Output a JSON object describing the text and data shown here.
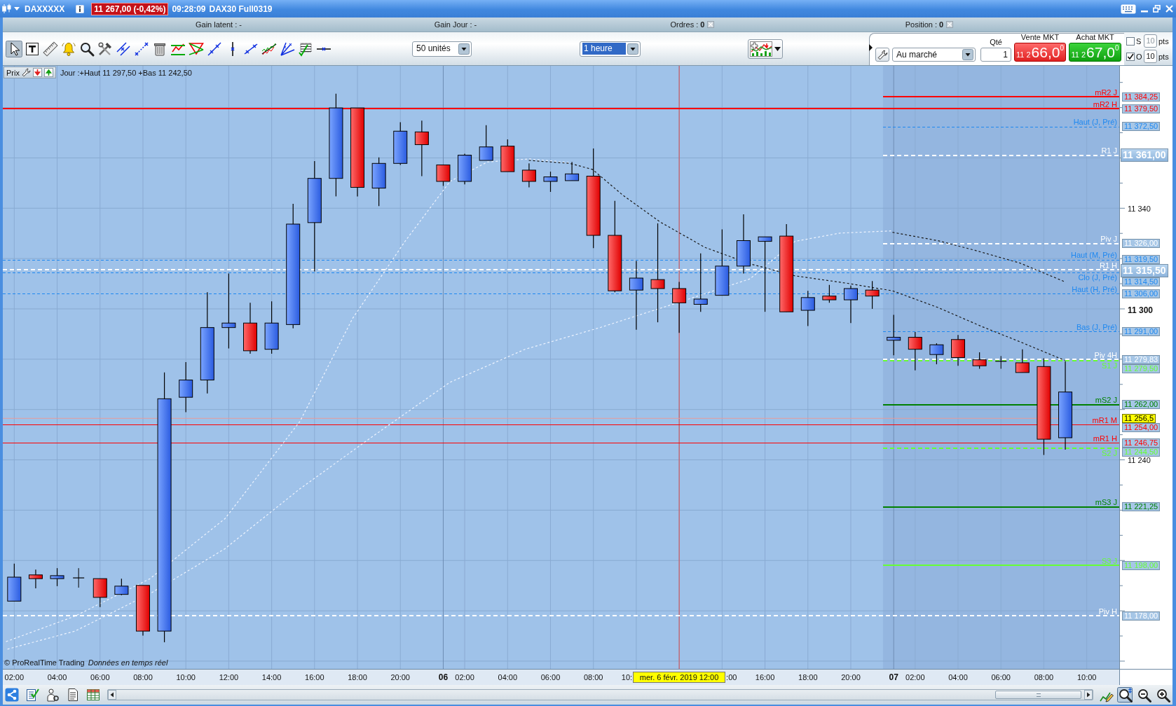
{
  "title_bar": {
    "instrument": "DAXXXXX",
    "last_price": "11 267,00 (-0,42%)",
    "time": "09:28:09",
    "contract": "DAX30 Full0319"
  },
  "info_bar": [
    {
      "text": "Gain latent : -",
      "kind": "value"
    },
    {
      "text": "Gain Jour : -",
      "kind": "value"
    },
    {
      "text": "Ordres : **0**",
      "kind": "count"
    },
    {
      "text": "Position : **0**",
      "kind": "count"
    }
  ],
  "toolbar": {
    "tools": [
      {
        "kind": "pointer",
        "selected": true
      },
      {
        "kind": "text",
        "selected": false
      },
      {
        "kind": "ruler",
        "selected": false
      },
      {
        "kind": "bell",
        "selected": false
      },
      {
        "kind": "search",
        "selected": false
      },
      {
        "kind": "tools",
        "selected": false
      },
      {
        "kind": "parallel",
        "selected": false
      },
      {
        "kind": "segment",
        "selected": false
      },
      {
        "kind": "trash",
        "selected": false
      },
      {
        "kind": "channel",
        "selected": false
      },
      {
        "kind": "triangle",
        "selected": false
      },
      {
        "kind": "line",
        "selected": false
      },
      {
        "kind": "vertical",
        "selected": false
      },
      {
        "kind": "ray",
        "selected": false
      },
      {
        "kind": "wave",
        "selected": false
      },
      {
        "kind": "fan",
        "selected": false
      },
      {
        "kind": "fibonacci",
        "selected": false
      },
      {
        "kind": "horizontal",
        "selected": false
      }
    ],
    "units": {
      "value": "50 unités",
      "highlighted": false
    },
    "timeframe": {
      "value": "1 heure",
      "highlighted": true
    }
  },
  "order_panel": {
    "order_type": "Au marché",
    "quantity": {
      "label": "Qté",
      "value": "1"
    },
    "market_buttons": [
      {
        "kind": "sell",
        "label": "Vente MKT",
        "prefix": "11 2",
        "main": "66,0",
        "sup": "0"
      },
      {
        "kind": "buy",
        "label": "Achat MKT",
        "prefix": "11 2",
        "main": "67,0",
        "sup": "0"
      }
    ],
    "options": [
      {
        "label": "S",
        "checked": false,
        "value": "10",
        "unit": "pts",
        "disabled": true
      },
      {
        "label": "O",
        "checked": true,
        "value": "10",
        "unit": "pts",
        "disabled": false
      }
    ]
  },
  "chart": {
    "legend": {
      "label": "Prix",
      "summary": "Jour :+Haut 11 297,50 +Bas 11 242,50"
    },
    "levels": [
      {
        "label": "mR2 J",
        "price": "11 384,25",
        "color": "#ff0000",
        "kind": "solid",
        "full_width": false,
        "emphasis": false
      },
      {
        "label": "mR2 H",
        "price": "11 379,50",
        "color": "#ff0000",
        "kind": "solid",
        "full_width": true,
        "emphasis": false
      },
      {
        "label": "Haut (J, Pré)",
        "price": "11 372,50",
        "color": "#1e88f0",
        "kind": "dashed",
        "full_width": false,
        "emphasis": false
      },
      {
        "label": "R1 J",
        "price": "11 361,00",
        "color": "#ffffff",
        "kind": "thick_dashed",
        "full_width": false,
        "emphasis": true
      },
      {
        "label": "Piv J",
        "price": "11 326,00",
        "color": "#ffffff",
        "kind": "thick_dashed",
        "full_width": false,
        "emphasis": false
      },
      {
        "label": "Haut (M, Pré)",
        "price": "11 319,50",
        "color": "#1e88f0",
        "kind": "dashed",
        "full_width": true,
        "emphasis": false
      },
      {
        "label": "R1 H",
        "price": "11 315,50",
        "color": "#ffffff",
        "kind": "thick_dashed",
        "full_width": true,
        "emphasis": true
      },
      {
        "label": "Clo (J, Pré)",
        "price": "11 314,50",
        "color": "#1e88f0",
        "kind": "dashed",
        "full_width": true,
        "emphasis": false
      },
      {
        "label": "Haut (H, Pré)",
        "price": "11 306,00",
        "color": "#1e88f0",
        "kind": "dashed",
        "full_width": true,
        "emphasis": false
      },
      {
        "label": "Bas (J, Pré)",
        "price": "11 291,00",
        "color": "#1e88f0",
        "kind": "dashed",
        "full_width": false,
        "emphasis": false
      },
      {
        "label": "Piv 4H",
        "price": "11 279,83",
        "color": "#ffffff",
        "kind": "thick_dashed",
        "full_width": false,
        "emphasis": false
      },
      {
        "label": "S1 J",
        "price": "11 279,50",
        "color": "#66ff33",
        "kind": "thick_dashed",
        "full_width": false,
        "emphasis": false
      },
      {
        "label": "mS2 J",
        "price": "11 262,00",
        "color": "#008000",
        "kind": "solid",
        "full_width": false,
        "emphasis": false
      },
      {
        "label": "mR1 M",
        "price": "11 254,00",
        "color": "#ff0000",
        "kind": "thin",
        "full_width": true,
        "emphasis": false
      },
      {
        "label": "mR1 H",
        "price": "11 246,75",
        "color": "#ff0000",
        "kind": "thin",
        "full_width": true,
        "emphasis": false
      },
      {
        "label": "S2 J",
        "price": "11 244,50",
        "color": "#66ff33",
        "kind": "thick_dashed",
        "full_width": false,
        "emphasis": false
      },
      {
        "label": "mS3 J",
        "price": "11 221,25",
        "color": "#008000",
        "kind": "solid",
        "full_width": false,
        "emphasis": false
      },
      {
        "label": "S3 J",
        "price": "11 198,00",
        "color": "#66ff33",
        "kind": "solid",
        "full_width": false,
        "emphasis": false
      },
      {
        "label": "Piv H",
        "price": "11 178,00",
        "color": "#ffffff",
        "kind": "thick_dashed",
        "full_width": true,
        "emphasis": false
      }
    ],
    "price_axis": {
      "ticks": [
        {
          "label": "11 340",
          "kind": "minor"
        },
        {
          "label": "11 300",
          "kind": "major"
        },
        {
          "label": "11 240",
          "kind": "minor"
        }
      ],
      "cursor_price": "11 256,5"
    },
    "time_axis": [
      {
        "label": "02:00",
        "kind": "hour"
      },
      {
        "label": "04:00",
        "kind": "hour"
      },
      {
        "label": "06:00",
        "kind": "hour"
      },
      {
        "label": "08:00",
        "kind": "hour"
      },
      {
        "label": "10:00",
        "kind": "hour"
      },
      {
        "label": "12:00",
        "kind": "hour"
      },
      {
        "label": "14:00",
        "kind": "hour"
      },
      {
        "label": "16:00",
        "kind": "hour"
      },
      {
        "label": "18:00",
        "kind": "hour"
      },
      {
        "label": "20:00",
        "kind": "hour"
      },
      {
        "label": "06",
        "kind": "day"
      },
      {
        "label": "02:00",
        "kind": "hour"
      },
      {
        "label": "04:00",
        "kind": "hour"
      },
      {
        "label": "06:00",
        "kind": "hour"
      },
      {
        "label": "08:00",
        "kind": "hour"
      },
      {
        "label": "10:",
        "kind": "clipped_right"
      },
      {
        "label": "mer. 6 févr. 2019 12:00",
        "kind": "cursor"
      },
      {
        "label": ":00",
        "kind": "clipped_left"
      },
      {
        "label": "16:00",
        "kind": "hour"
      },
      {
        "label": "18:00",
        "kind": "hour"
      },
      {
        "label": "20:00",
        "kind": "hour"
      },
      {
        "label": "07",
        "kind": "day"
      },
      {
        "label": "02:00",
        "kind": "hour"
      },
      {
        "label": "04:00",
        "kind": "hour"
      },
      {
        "label": "06:00",
        "kind": "hour"
      },
      {
        "label": "08:00",
        "kind": "hour"
      },
      {
        "label": "10:00",
        "kind": "hour"
      }
    ],
    "footer": {
      "copyright": "© ProRealTime Trading",
      "feed": "Données en temps réel"
    }
  },
  "bottom_toolbar": {
    "left_tools": [
      {
        "kind": "share"
      },
      {
        "kind": "checklist"
      },
      {
        "kind": "person"
      },
      {
        "kind": "document"
      },
      {
        "kind": "table"
      }
    ],
    "right_tools": [
      {
        "kind": "draw",
        "selected": false
      },
      {
        "kind": "zoom_fit",
        "selected": true
      },
      {
        "kind": "zoom_out",
        "selected": false
      },
      {
        "kind": "zoom_in",
        "selected": false
      }
    ]
  }
}
